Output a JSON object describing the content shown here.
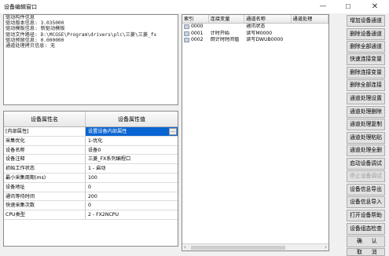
{
  "window": {
    "title": "设备编辑窗口",
    "minimize": "—",
    "maximize": "☐",
    "close": "✕"
  },
  "driver_info": {
    "lines": [
      "驱动构件信息",
      "驱动版本信息: 3.035000",
      "驱动模版信息: 新驱动模板",
      "驱动文件路径: D:\\MCGSE\\Program\\drivers\\plc\\三菱\\三菱_fx",
      "驱动预留信息: 0.000000",
      "通道处理拷贝信息: 无"
    ]
  },
  "properties": {
    "header_name": "设备属性名",
    "header_value": "设备属性值",
    "dots_label": "...",
    "rows": [
      {
        "name": "[内部属性]",
        "value": "设置设备内部属性"
      },
      {
        "name": "采集优化",
        "value": "1-优化"
      },
      {
        "name": "设备名称",
        "value": "设备0"
      },
      {
        "name": "设备注释",
        "value": "三菱_FX系列编程口"
      },
      {
        "name": "初始工作状态",
        "value": "1 - 启动"
      },
      {
        "name": "最小采集周期(ms)",
        "value": "100"
      },
      {
        "name": "设备地址",
        "value": "0"
      },
      {
        "name": "通讯等待时间",
        "value": "200"
      },
      {
        "name": "快速采集次数",
        "value": "0"
      },
      {
        "name": "CPU类型",
        "value": "2 - FX2NCPU"
      }
    ]
  },
  "channels": {
    "headers": [
      "索引",
      "连接变量",
      "通道名称",
      "通道处理"
    ],
    "rows": [
      {
        "index": "0000",
        "variable": "",
        "name": "通讯状态",
        "process": ""
      },
      {
        "index": "0001",
        "variable": "计时开始",
        "name": "读写M0000",
        "process": ""
      },
      {
        "index": "0002",
        "variable": "倒计时时间值",
        "name": "读写DWUB0000",
        "process": ""
      }
    ],
    "scroll_left": "‹",
    "scroll_right": "›"
  },
  "buttons": {
    "add_channel": "增加设备通道",
    "delete_channel": "删除设备通道",
    "delete_all_channels": "删除全部通道",
    "quick_link_var": "快速连接变量",
    "delete_link_var": "删除连接变量",
    "delete_all_links": "删除全部连接",
    "channel_proc_setup": "通道处理设置",
    "channel_proc_delete": "通道处理删除",
    "channel_proc_copy": "通道处理复制",
    "channel_proc_paste": "通道处理粘贴",
    "channel_proc_delete_all": "通道处理全删",
    "start_debug": "启动设备调试",
    "stop_debug": "停止设备调试",
    "export_info": "设备信息导出",
    "import_info": "设备信息导入",
    "open_help": "打开设备帮助",
    "device_check": "设备组态检查",
    "confirm": "确认",
    "cancel": "取消"
  }
}
